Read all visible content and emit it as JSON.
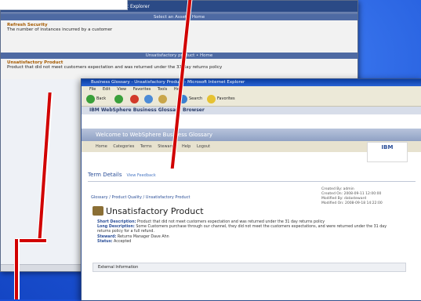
{
  "back_window": {
    "title": "Microsoft Internet Explorer",
    "header1": "Select an Asset   •   Home",
    "row1_title": "Refresh Security",
    "row1_text": "The number of instances incurred by a customer",
    "header2": "Unsatisfactory product   •   Home",
    "row2_title": "Unsatisfactory Product",
    "row2_text": "Product that did not meet customers expectation and was returned under the 31 day returns policy"
  },
  "front_window": {
    "title": "Business Glossary - Unsatisfactory Product - Microsoft Internet Explorer",
    "menu": [
      "File",
      "Edit",
      "View",
      "Favorites",
      "Tools",
      "Help"
    ],
    "toolbar": {
      "back": "Back",
      "search": "Search",
      "favorites": "Favorites"
    },
    "brand_bar": "IBM  WebSphere Business Glossary Browser",
    "welcome": "Welcome to WebSphere Business Glossary",
    "nav": [
      "Home",
      "Categories",
      "Terms",
      "Stewards",
      "Help",
      "Logout"
    ],
    "logo": "IBM",
    "term_details": "Term Details",
    "term_details_link": "View Feedback",
    "breadcrumb": "Glossary / Product Quality / Unsatisfactory Product",
    "meta": [
      "Created By: admin",
      "Created On: 2008-09-11 12:00:00",
      "Modified By: datasteward",
      "Modified On: 2008-09-18 14:22:00"
    ],
    "product_title": "Unsatisfactory Product",
    "short_desc_label": "Short Description:",
    "short_desc": "Product that did not meet customers expectation and was returned under the 31 day returns policy",
    "long_desc_label": "Long Description:",
    "long_desc": "Some Customers purchase through our channel, they did not meet the customers expectations, and were returned under the 31 day returns policy for a full refund.",
    "steward_label": "Steward:",
    "steward": "Returns Manager  Dave Ahn",
    "status_label": "Status:",
    "status": "Accepted",
    "external": "External Information"
  }
}
